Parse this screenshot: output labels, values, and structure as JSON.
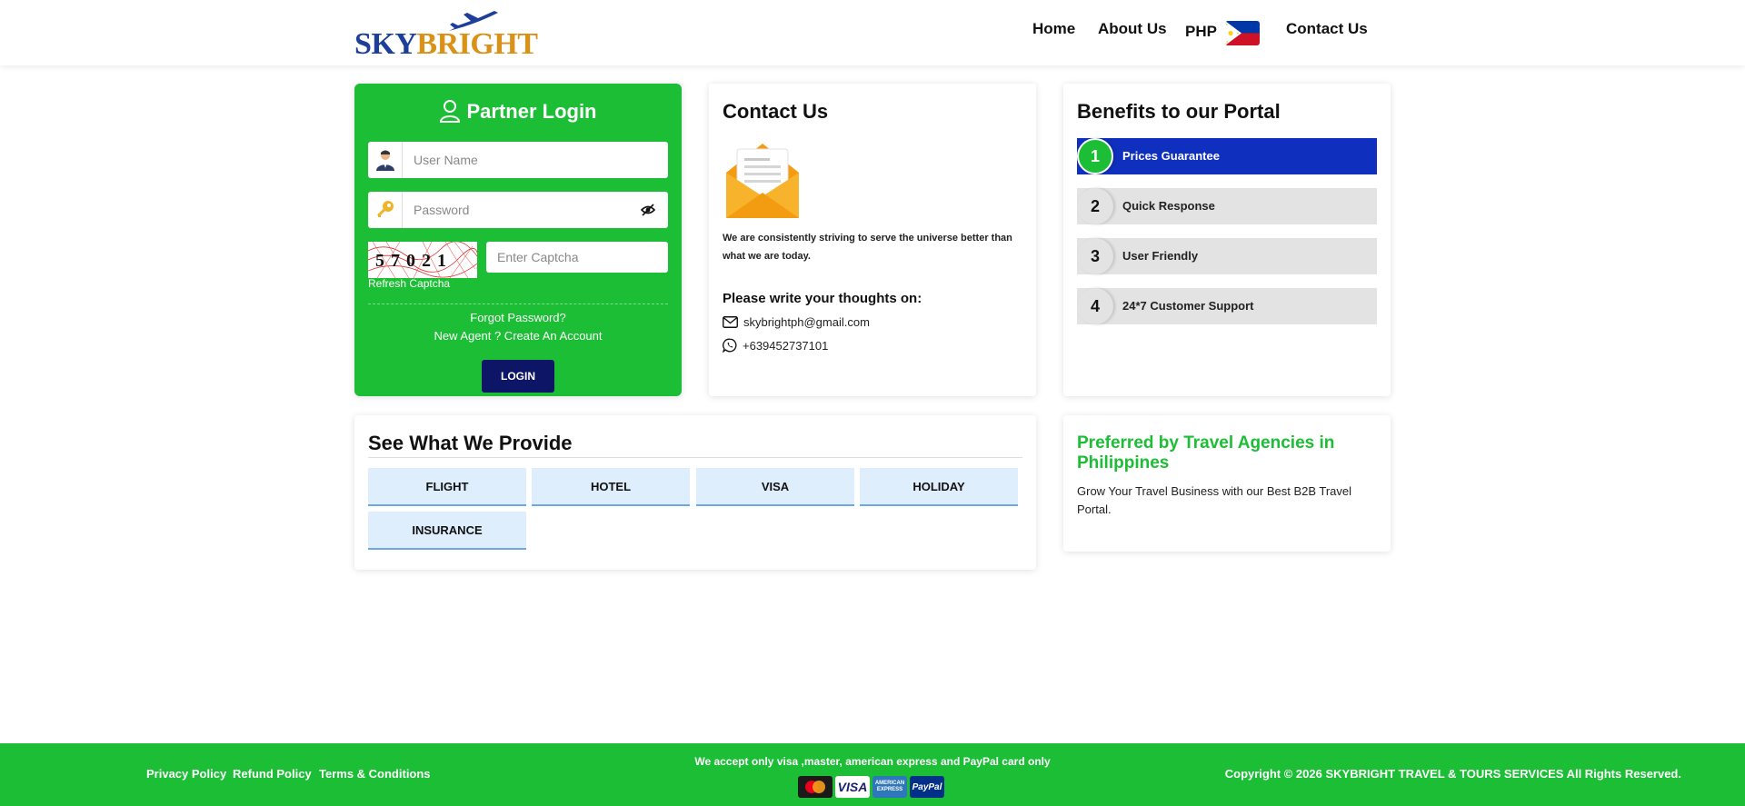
{
  "header": {
    "logo": {
      "part1": "SKY",
      "part2": "BRIGHT"
    },
    "nav": {
      "home": "Home",
      "about": "About Us",
      "currency": "PHP",
      "contact": "Contact Us"
    }
  },
  "login": {
    "title": "Partner Login",
    "username_placeholder": "User Name",
    "password_placeholder": "Password",
    "captcha_text": "57021",
    "captcha_placeholder": "Enter Captcha",
    "refresh_label": "Refresh Captcha",
    "forgot_label": "Forgot Password?",
    "create_label": "New Agent ? Create An Account",
    "login_label": "LOGIN"
  },
  "contact": {
    "title": "Contact Us",
    "description": "We are consistently striving to serve the universe better than what we are today.",
    "thoughts_label": "Please write your thoughts on:",
    "email": "skybrightph@gmail.com",
    "phone": "+639452737101"
  },
  "benefits": {
    "title": "Benefits to our Portal",
    "items": [
      {
        "num": "1",
        "label": "Prices Guarantee"
      },
      {
        "num": "2",
        "label": "Quick Response"
      },
      {
        "num": "3",
        "label": "User Friendly"
      },
      {
        "num": "4",
        "label": "24*7 Customer Support"
      }
    ]
  },
  "provide": {
    "title": "See What We Provide",
    "services": [
      "FLIGHT",
      "HOTEL",
      "VISA",
      "HOLIDAY",
      "INSURANCE"
    ]
  },
  "preferred": {
    "title": "Preferred by Travel Agencies in Philippines",
    "description": "Grow Your Travel Business with our Best B2B Travel Portal."
  },
  "footer": {
    "links": [
      "Privacy Policy",
      "Refund Policy",
      "Terms & Conditions"
    ],
    "accept_text": "We accept only visa ,master, american express and PayPal card only",
    "payment_cards": [
      "MasterCard",
      "VISA",
      "AMERICAN EXPRESS",
      "PayPal"
    ],
    "copyright": "Copyright © 2026 SKYBRIGHT TRAVEL & TOURS SERVICES All Rights Reserved."
  },
  "colors": {
    "brand_green": "#1bbe34",
    "navy": "#0d1566",
    "active_blue": "#0f2fbf",
    "logo_blue": "#1d3f9a",
    "logo_gold": "#d99117"
  }
}
